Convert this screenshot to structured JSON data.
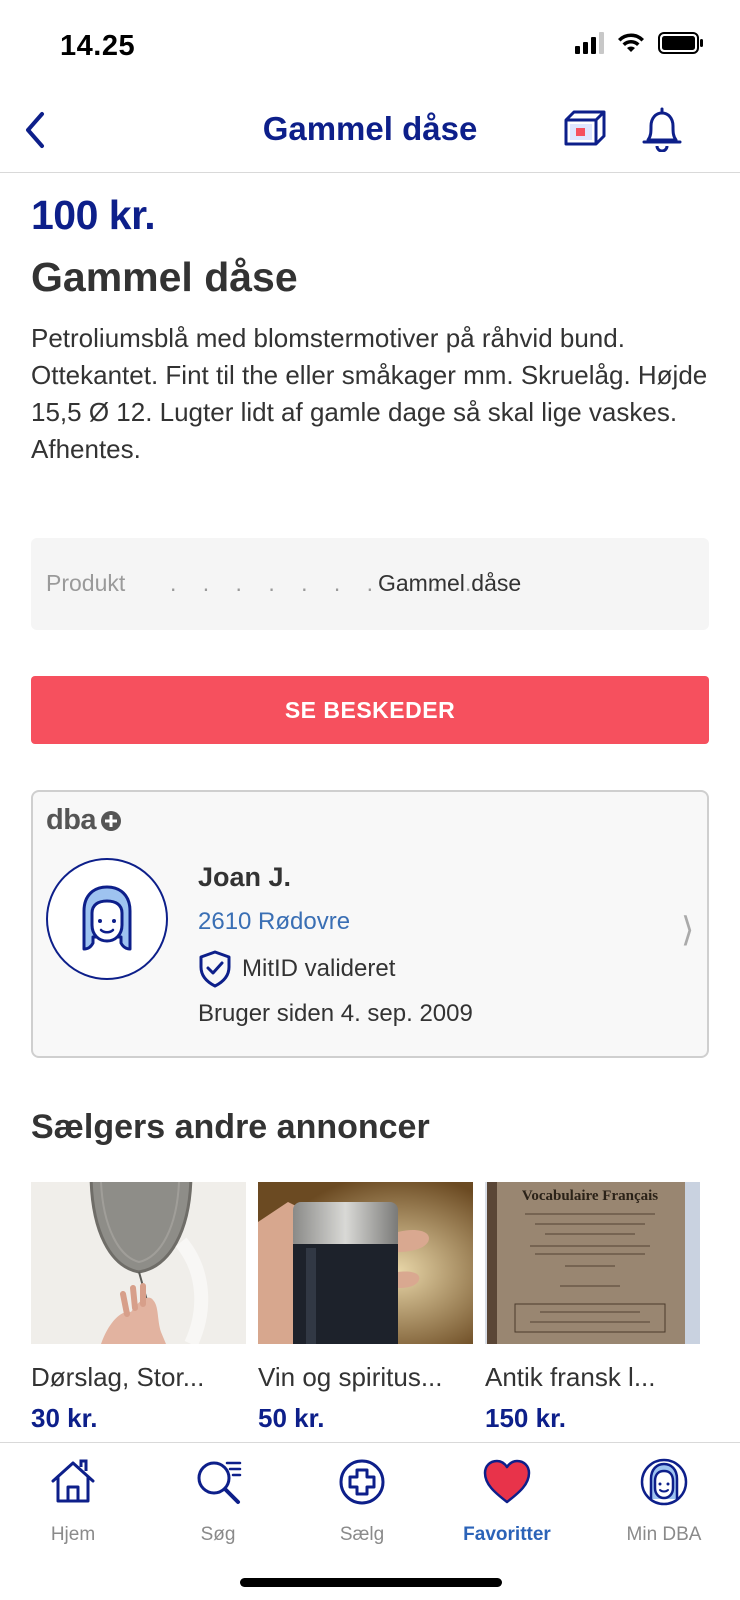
{
  "status_bar": {
    "time": "14.25"
  },
  "nav": {
    "title": "Gammel dåse"
  },
  "listing": {
    "price": "100 kr.",
    "title": "Gammel dåse",
    "description": "Petroliumsblå med blomstermotiver på råhvid bund. Ottekantet. Fint til the eller småkager mm. Skruelåg. Højde 15,5 Ø 12. Lugter lidt af gamle dage så skal lige vaskes.\nAfhentes.",
    "product_label": "Produkt",
    "product_dots": ". . . . . . . . . .",
    "product_value": "Gammel dåse",
    "messages_button": "SE BESKEDER"
  },
  "seller": {
    "logo_text": "dba",
    "name": "Joan J.",
    "location": "2610 Rødovre",
    "verified": "MitID valideret",
    "member_since": "Bruger siden 4. sep. 2009"
  },
  "other_listings": {
    "title": "Sælgers andre annoncer",
    "items": [
      {
        "title": "Dørslag, Stor...",
        "price": "30 kr."
      },
      {
        "title": "Vin og spiritus...",
        "price": "50 kr."
      },
      {
        "title": "Antik fransk l...",
        "price": "150 kr.",
        "image_text": "Vocabulaire Français"
      }
    ]
  },
  "tabs": [
    {
      "label": "Hjem",
      "icon": "home-icon"
    },
    {
      "label": "Søg",
      "icon": "search-icon"
    },
    {
      "label": "Sælg",
      "icon": "plus-circle-icon"
    },
    {
      "label": "Favoritter",
      "icon": "heart-icon",
      "active": true
    },
    {
      "label": "Min DBA",
      "icon": "profile-icon"
    }
  ],
  "colors": {
    "brand": "#0d1f8a",
    "accent": "#f6505e",
    "link": "#3a6fb4",
    "active_tab": "#2b63b8"
  }
}
